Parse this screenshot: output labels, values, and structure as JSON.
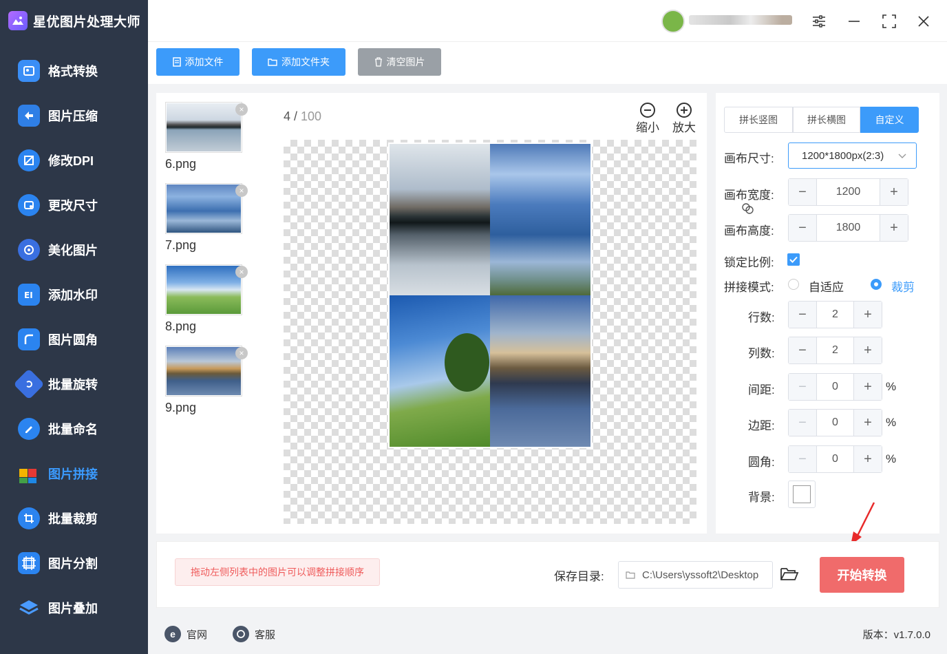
{
  "app": {
    "title": "星优图片处理大师"
  },
  "sidebar": {
    "items": [
      {
        "label": "格式转换",
        "icon": "image-convert-icon"
      },
      {
        "label": "图片压缩",
        "icon": "compress-icon"
      },
      {
        "label": "修改DPI",
        "icon": "dpi-icon"
      },
      {
        "label": "更改尺寸",
        "icon": "resize-icon"
      },
      {
        "label": "美化图片",
        "icon": "beautify-icon"
      },
      {
        "label": "添加水印",
        "icon": "watermark-icon"
      },
      {
        "label": "图片圆角",
        "icon": "rounded-corner-icon"
      },
      {
        "label": "批量旋转",
        "icon": "rotate-icon"
      },
      {
        "label": "批量命名",
        "icon": "rename-icon"
      },
      {
        "label": "图片拼接",
        "icon": "puzzle-icon",
        "active": true
      },
      {
        "label": "批量裁剪",
        "icon": "crop-icon"
      },
      {
        "label": "图片分割",
        "icon": "split-icon"
      },
      {
        "label": "图片叠加",
        "icon": "layers-icon"
      }
    ]
  },
  "toolbar": {
    "add_file": "添加文件",
    "add_folder": "添加文件夹",
    "clear": "清空图片"
  },
  "thumbnails": [
    {
      "name": "6.png"
    },
    {
      "name": "7.png"
    },
    {
      "name": "8.png"
    },
    {
      "name": "9.png"
    }
  ],
  "preview": {
    "current": "4",
    "separator": " / ",
    "total": "100",
    "zoom_out": "缩小",
    "zoom_in": "放大"
  },
  "settings": {
    "tabs": [
      "拼长竖图",
      "拼长横图",
      "自定义"
    ],
    "active_tab": "自定义",
    "canvas_size_label": "画布尺寸:",
    "canvas_size_value": "1200*1800px(2:3)",
    "canvas_width_label": "画布宽度:",
    "canvas_width": "1200",
    "canvas_height_label": "画布高度:",
    "canvas_height": "1800",
    "lock_ratio_label": "锁定比例:",
    "lock_ratio": true,
    "mode_label": "拼接模式:",
    "mode_fit": "自适应",
    "mode_crop": "裁剪",
    "mode_selected": "裁剪",
    "rows_label": "行数:",
    "rows": "2",
    "cols_label": "列数:",
    "cols": "2",
    "spacing_label": "间距:",
    "spacing": "0",
    "margin_label": "边距:",
    "margin": "0",
    "radius_label": "圆角:",
    "radius": "0",
    "percent": "%",
    "background_label": "背景:",
    "background_color": "#ffffff"
  },
  "action": {
    "hint": "拖动左侧列表中的图片可以调整拼接顺序",
    "save_label": "保存目录:",
    "save_path": "C:\\Users\\yssoft2\\Desktop",
    "start": "开始转换"
  },
  "footer": {
    "website": "官网",
    "support": "客服",
    "version": "版本：v1.7.0.0"
  },
  "colors": {
    "sidebar_bg": "#2d3748",
    "accent": "#3c9bfa",
    "start_button": "#f06b6b"
  }
}
